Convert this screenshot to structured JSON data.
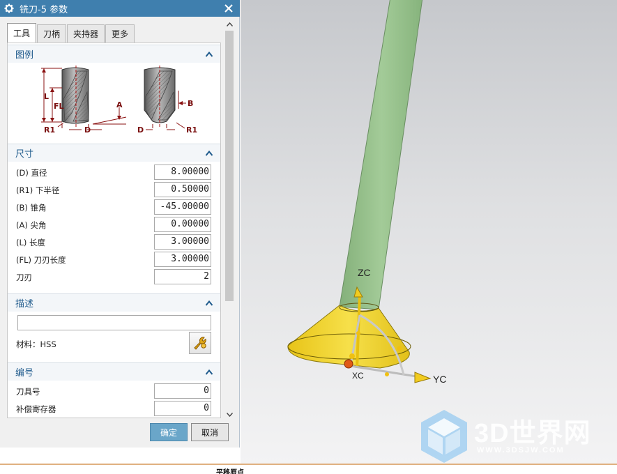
{
  "dialog": {
    "title": "铣刀-5 参数",
    "tabs": [
      {
        "label": "工具",
        "active": true
      },
      {
        "label": "刀柄",
        "active": false
      },
      {
        "label": "夹持器",
        "active": false
      },
      {
        "label": "更多",
        "active": false
      }
    ],
    "sections": {
      "legend": {
        "label": "图例"
      },
      "dimensions": {
        "label": "尺寸"
      },
      "description": {
        "label": "描述"
      },
      "numbering": {
        "label": "编号"
      }
    },
    "diagram_labels": {
      "l": "L",
      "fl": "FL",
      "r1_left": "R1",
      "d_left": "D",
      "a": "A",
      "b": "B",
      "d_right": "D",
      "r1_right": "R1"
    },
    "dimensions": [
      {
        "label": "(D) 直径",
        "value": "8.00000"
      },
      {
        "label": "(R1) 下半径",
        "value": "0.50000"
      },
      {
        "label": "(B) 锥角",
        "value": "-45.00000"
      },
      {
        "label": "(A) 尖角",
        "value": "0.00000"
      },
      {
        "label": "(L) 长度",
        "value": "3.00000"
      },
      {
        "label": "(FL) 刀刃长度",
        "value": "3.00000"
      },
      {
        "label": "刀刃",
        "value": "2"
      }
    ],
    "description_value": "",
    "material_label": "材料：HSS",
    "numbering": [
      {
        "label": "刀具号",
        "value": "0"
      },
      {
        "label": "补偿寄存器",
        "value": "0"
      }
    ],
    "ok_label": "确定",
    "cancel_label": "取消"
  },
  "viewport": {
    "axes": {
      "z": "ZC",
      "y": "YC",
      "x": "XC"
    },
    "colors": {
      "shank": "#93c088",
      "cone": "#f2d42a",
      "x_axis": "#e04a1a",
      "z_axis": "#2358c8",
      "y_axis": "#2a8a3e"
    }
  },
  "watermark": {
    "text": "3D世界网",
    "url": "WWW.3DSJW.COM"
  },
  "status": {
    "text": "平移原点"
  }
}
